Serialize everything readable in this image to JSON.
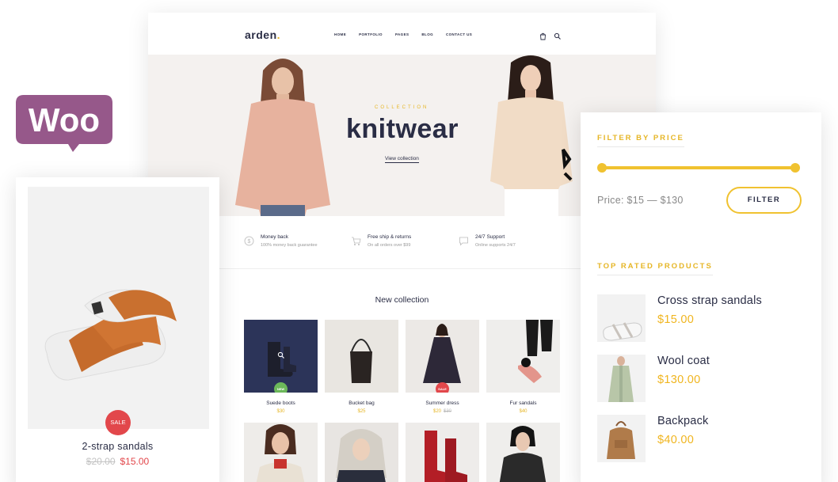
{
  "store": {
    "logo": "arden",
    "menu": [
      "HOME",
      "PORTFOLIO",
      "PAGES",
      "BLOG",
      "CONTACT US"
    ],
    "cart_count": "0",
    "hero": {
      "eyebrow": "COLLECTION",
      "title": "knitwear",
      "link": "View collection"
    },
    "features": [
      {
        "icon": "dollar-icon",
        "title": "Money back",
        "sub": "100% money back guarantee"
      },
      {
        "icon": "cart-icon",
        "title": "Free ship & returns",
        "sub": "On all orders over $99"
      },
      {
        "icon": "chat-icon",
        "title": "24/7 Support",
        "sub": "Online supports 24/7"
      }
    ],
    "section_title": "New collection",
    "products": [
      {
        "name": "Suede boots",
        "price": "$30",
        "old": "",
        "badge": "NEW"
      },
      {
        "name": "Bucket bag",
        "price": "$25",
        "old": "",
        "badge": ""
      },
      {
        "name": "Summer dress",
        "price": "$20",
        "old": "$30",
        "badge": "SALE"
      },
      {
        "name": "Fur sandals",
        "price": "$40",
        "old": "",
        "badge": ""
      }
    ]
  },
  "left_card": {
    "badge": "SALE",
    "name": "2-strap sandals",
    "old_price": "$20.00",
    "price": "$15.00"
  },
  "panel": {
    "filter_heading": "FILTER BY PRICE",
    "price_label": "Price: $15 — $130",
    "filter_button": "FILTER",
    "range": {
      "min": 15,
      "max": 130
    },
    "top_heading": "TOP RATED PRODUCTS",
    "top_products": [
      {
        "name": "Cross strap sandals",
        "price": "$15.00"
      },
      {
        "name": "Wool coat",
        "price": "$130.00"
      },
      {
        "name": "Backpack",
        "price": "$40.00"
      }
    ]
  },
  "colors": {
    "accent": "#f0c230",
    "sale": "#e2474b",
    "new": "#6cb85a",
    "navy": "#2a2d45",
    "woo": "#96588a"
  },
  "woo_logo": "Woo"
}
